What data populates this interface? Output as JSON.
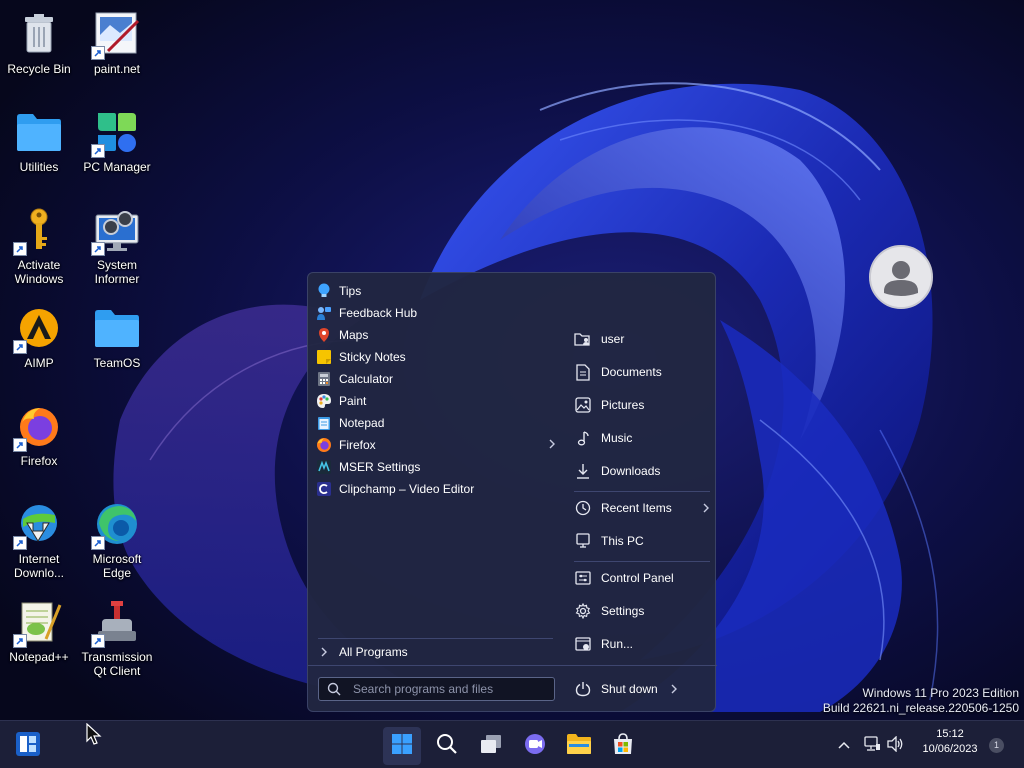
{
  "desktop": {
    "icons": [
      {
        "label": "Recycle Bin",
        "icon": "recycle-bin-icon"
      },
      {
        "label": "paint.net",
        "icon": "paint-net-icon"
      },
      {
        "label": "Utilities",
        "icon": "folder-icon"
      },
      {
        "label": "PC Manager",
        "icon": "pc-manager-icon"
      },
      {
        "label": "Activate Windows",
        "icon": "key-icon"
      },
      {
        "label": "System Informer",
        "icon": "system-informer-icon"
      },
      {
        "label": "AIMP",
        "icon": "aimp-icon"
      },
      {
        "label": "TeamOS",
        "icon": "folder-icon"
      },
      {
        "label": "Firefox",
        "icon": "firefox-icon"
      },
      {
        "label": "Internet Downlo...",
        "icon": "idm-icon"
      },
      {
        "label": "Microsoft Edge",
        "icon": "edge-icon"
      },
      {
        "label": "Notepad++",
        "icon": "notepad-plus-plus-icon"
      },
      {
        "label": "Transmission Qt Client",
        "icon": "transmission-icon"
      }
    ],
    "watermark": {
      "line1": "Windows 11 Pro 2023 Edition",
      "line2": "Build 22621.ni_release.220506-1250"
    }
  },
  "start_menu": {
    "programs": [
      {
        "label": "Tips",
        "icon": "tips-icon",
        "color": "#3ea3ff"
      },
      {
        "label": "Feedback Hub",
        "icon": "feedback-hub-icon",
        "color": "#2a7fd6"
      },
      {
        "label": "Maps",
        "icon": "maps-icon",
        "color": "#e0452a"
      },
      {
        "label": "Sticky Notes",
        "icon": "sticky-notes-icon",
        "color": "#f6c400"
      },
      {
        "label": "Calculator",
        "icon": "calculator-icon",
        "color": "#6f7686"
      },
      {
        "label": "Paint",
        "icon": "paint-icon",
        "color": "#e07a22"
      },
      {
        "label": "Notepad",
        "icon": "notepad-icon",
        "color": "#3d9be6"
      },
      {
        "label": "Firefox",
        "icon": "firefox-icon",
        "color": "#ff7a1a"
      },
      {
        "label": "MSER Settings",
        "icon": "mser-settings-icon",
        "color": "#45c4e6"
      },
      {
        "label": "Clipchamp – Video Editor",
        "icon": "clipchamp-icon",
        "color": "#2a2f8f"
      }
    ],
    "all_programs": "All Programs",
    "search_placeholder": "Search programs and files",
    "right_items": [
      {
        "label": "user",
        "icon": "user-folder-icon"
      },
      {
        "label": "Documents",
        "icon": "documents-icon"
      },
      {
        "label": "Pictures",
        "icon": "pictures-icon"
      },
      {
        "label": "Music",
        "icon": "music-icon"
      },
      {
        "label": "Downloads",
        "icon": "downloads-icon"
      },
      {
        "label": "Recent Items",
        "icon": "clock-icon"
      },
      {
        "label": "This PC",
        "icon": "computer-icon"
      },
      {
        "label": "Control Panel",
        "icon": "control-panel-icon"
      },
      {
        "label": "Settings",
        "icon": "gear-icon"
      },
      {
        "label": "Run...",
        "icon": "run-icon"
      }
    ],
    "shutdown": "Shut down"
  },
  "taskbar": {
    "time": "15:12",
    "date": "10/06/2023",
    "notification_count": "1",
    "accent": "#0f78d4"
  }
}
